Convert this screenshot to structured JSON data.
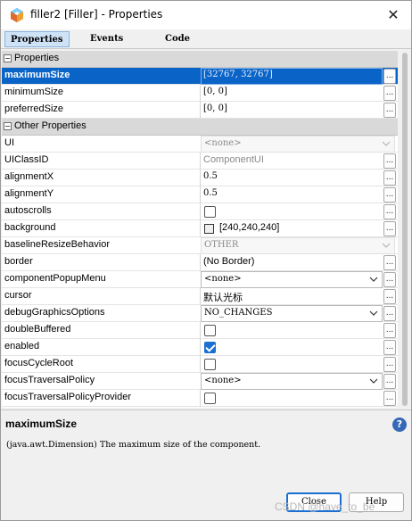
{
  "window": {
    "title": "filler2 [Filler] - Properties",
    "close_icon": "close-icon",
    "app_icon": "netbeans-cube-icon"
  },
  "tabs": [
    {
      "label": "Properties",
      "active": true
    },
    {
      "label": "Events",
      "active": false
    },
    {
      "label": "Code",
      "active": false
    }
  ],
  "categories": {
    "properties": "Properties",
    "other": "Other Properties",
    "collapse_symbol": "−"
  },
  "rows": {
    "maximumSize": {
      "name": "maximumSize",
      "value": "[32767, 32767]"
    },
    "minimumSize": {
      "name": "minimumSize",
      "value": "[0, 0]"
    },
    "preferredSize": {
      "name": "preferredSize",
      "value": "[0, 0]"
    },
    "UI": {
      "name": "UI",
      "value": "<none>"
    },
    "UIClassID": {
      "name": "UIClassID",
      "value": "ComponentUI"
    },
    "alignmentX": {
      "name": "alignmentX",
      "value": "0.5"
    },
    "alignmentY": {
      "name": "alignmentY",
      "value": "0.5"
    },
    "autoscrolls": {
      "name": "autoscrolls",
      "checked": false
    },
    "background": {
      "name": "background",
      "value": "[240,240,240]",
      "swatch": "#f0f0f0"
    },
    "baselineResizeBehavior": {
      "name": "baselineResizeBehavior",
      "value": "OTHER"
    },
    "border": {
      "name": "border",
      "value": "(No Border)"
    },
    "componentPopupMenu": {
      "name": "componentPopupMenu",
      "value": "<none>"
    },
    "cursor": {
      "name": "cursor",
      "value": "默认光标"
    },
    "debugGraphicsOptions": {
      "name": "debugGraphicsOptions",
      "value": "NO_CHANGES"
    },
    "doubleBuffered": {
      "name": "doubleBuffered",
      "checked": false
    },
    "enabled": {
      "name": "enabled",
      "checked": true
    },
    "focusCycleRoot": {
      "name": "focusCycleRoot",
      "checked": false
    },
    "focusTraversalPolicy": {
      "name": "focusTraversalPolicy",
      "value": "<none>"
    },
    "focusTraversalPolicyProvider": {
      "name": "focusTraversalPolicyProvider",
      "checked": false
    }
  },
  "ellipsis": "...",
  "description": {
    "title": "maximumSize",
    "text": "(java.awt.Dimension) The maximum size of the component.",
    "help_icon": "?"
  },
  "buttons": {
    "close": "Close",
    "help": "Help"
  },
  "watermark": "CSDN @have_to_be",
  "colors": {
    "selection": "#0a64c8",
    "category_bg": "#d9d9d9",
    "checkbox_on": "#1a6fd1"
  }
}
